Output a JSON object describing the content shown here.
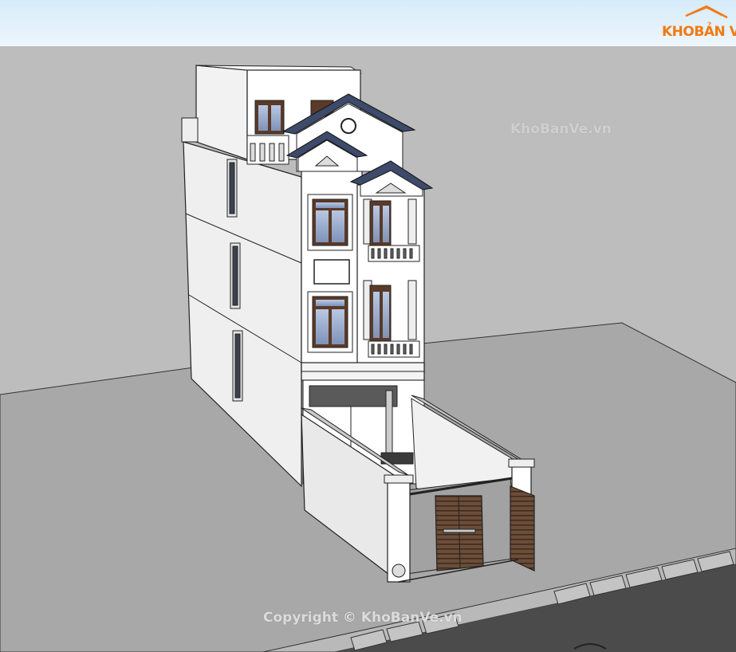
{
  "logo": {
    "part1": "KHO",
    "part2": "BẢN VẼ"
  },
  "watermark_top": "KhoBanVe.vn",
  "watermark_bottom": "Copyright © KhoBanVe.vn",
  "colors": {
    "sky_top": "#d8ecfa",
    "sky_bottom": "#eaf4fb",
    "ground": "#a9a9a9",
    "road": "#4a4a4a",
    "wall_white": "#ffffff",
    "wall_shade": "#e9e9e9",
    "roof": "#3d4a6a",
    "window_frame": "#5a3a28",
    "glass": "#8fa4c8",
    "gate": "#6b4d38",
    "brand_orange": "#f07a13"
  },
  "icons": [
    "house-roof-logo-icon"
  ]
}
